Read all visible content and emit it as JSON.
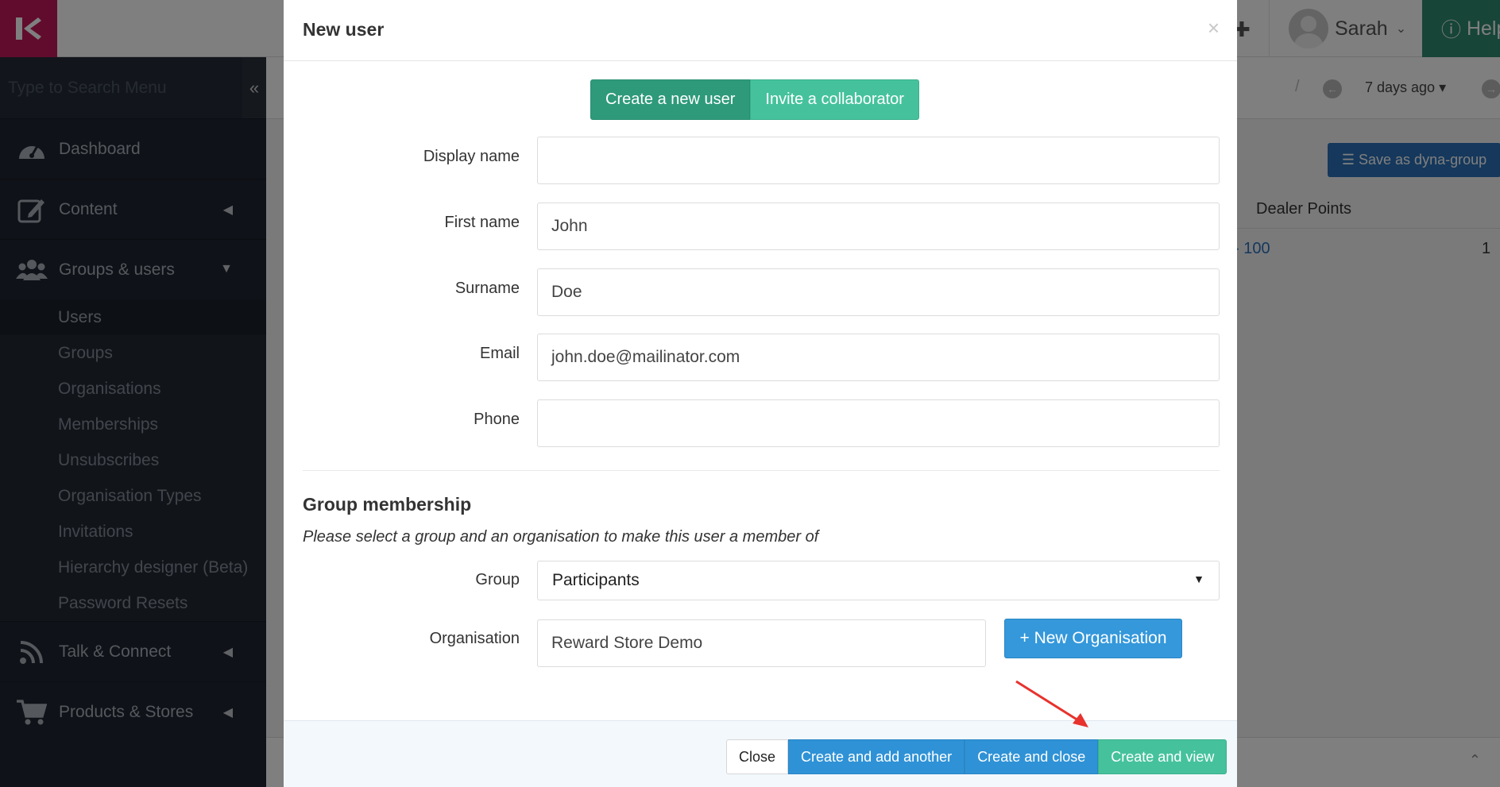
{
  "topbar": {
    "user_name": "Sarah",
    "help_label": "Help"
  },
  "sidebar": {
    "search_placeholder": "Type to Search Menu",
    "items": [
      {
        "label": "Dashboard",
        "icon": "dashboard-icon"
      },
      {
        "label": "Content",
        "icon": "edit-icon"
      },
      {
        "label": "Groups & users",
        "icon": "users-icon"
      },
      {
        "label": "Talk & Connect",
        "icon": "rss-icon"
      },
      {
        "label": "Products & Stores",
        "icon": "cart-icon"
      }
    ],
    "subitems": [
      "Users",
      "Groups",
      "Organisations",
      "Memberships",
      "Unsubscribes",
      "Organisation Types",
      "Invitations",
      "Hierarchy designer (Beta)",
      "Password Resets"
    ]
  },
  "background": {
    "period": "7 days ago",
    "save_dyna_group": "Save as dyna-group",
    "column_header": "Dealer Points",
    "link_value": "- 100",
    "count_value": "1"
  },
  "modal": {
    "title": "New user",
    "close_symbol": "×",
    "tabs": {
      "create": "Create a new user",
      "invite": "Invite a collaborator"
    },
    "fields": {
      "display_name": {
        "label": "Display name",
        "value": ""
      },
      "first_name": {
        "label": "First name",
        "value": "John"
      },
      "surname": {
        "label": "Surname",
        "value": "Doe"
      },
      "email": {
        "label": "Email",
        "value": "john.doe@mailinator.com"
      },
      "phone": {
        "label": "Phone",
        "value": ""
      }
    },
    "group_membership": {
      "title": "Group membership",
      "help": "Please select a group and an organisation to make this user a member of",
      "group_label": "Group",
      "group_value": "Participants",
      "organisation_label": "Organisation",
      "organisation_value": "Reward Store Demo",
      "new_org_button": "+ New Organisation"
    },
    "footer": {
      "close": "Close",
      "create_add_another": "Create and add another",
      "create_close": "Create and close",
      "create_view": "Create and view"
    }
  },
  "colors": {
    "accent_green": "#45c29c",
    "primary_blue": "#2f92d6",
    "logo_pink": "#c2185b",
    "annotation_red": "#e8322d"
  }
}
